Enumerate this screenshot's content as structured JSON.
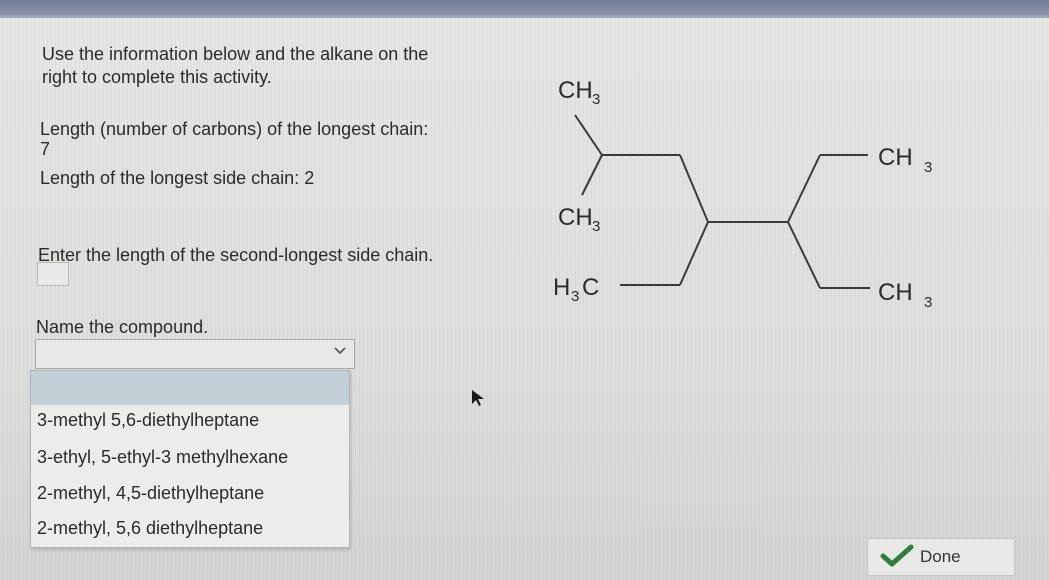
{
  "instructions": {
    "line1": "Use the information below and the alkane on the",
    "line2": "right to complete this activity."
  },
  "longest_chain": {
    "label": "Length (number of carbons) of the longest chain:",
    "value": "7"
  },
  "longest_side_chain": {
    "label": "Length of the longest side chain: 2"
  },
  "second_side_chain": {
    "prompt": "Enter the length of the second-longest side chain.",
    "value": ""
  },
  "name_compound": {
    "label": "Name the compound.",
    "selected": "",
    "options": [
      "3-methyl 5,6-diethylheptane",
      "3-ethyl, 5-ethyl-3 methylhexane",
      "2-methyl, 4,5-diethylheptane",
      "2-methyl, 5,6 diethylheptane"
    ]
  },
  "molecule": {
    "groups": {
      "top": "CH",
      "top_sub": "3",
      "mid": "CH",
      "mid_sub": "3",
      "bottom_left_main": "H",
      "bottom_left_sub": "3",
      "bottom_left_end": "C",
      "right_top": "CH",
      "right_top_sub": "3",
      "right_bottom": "CH",
      "right_bottom_sub": "3"
    }
  },
  "done_button": {
    "label": "Done"
  }
}
